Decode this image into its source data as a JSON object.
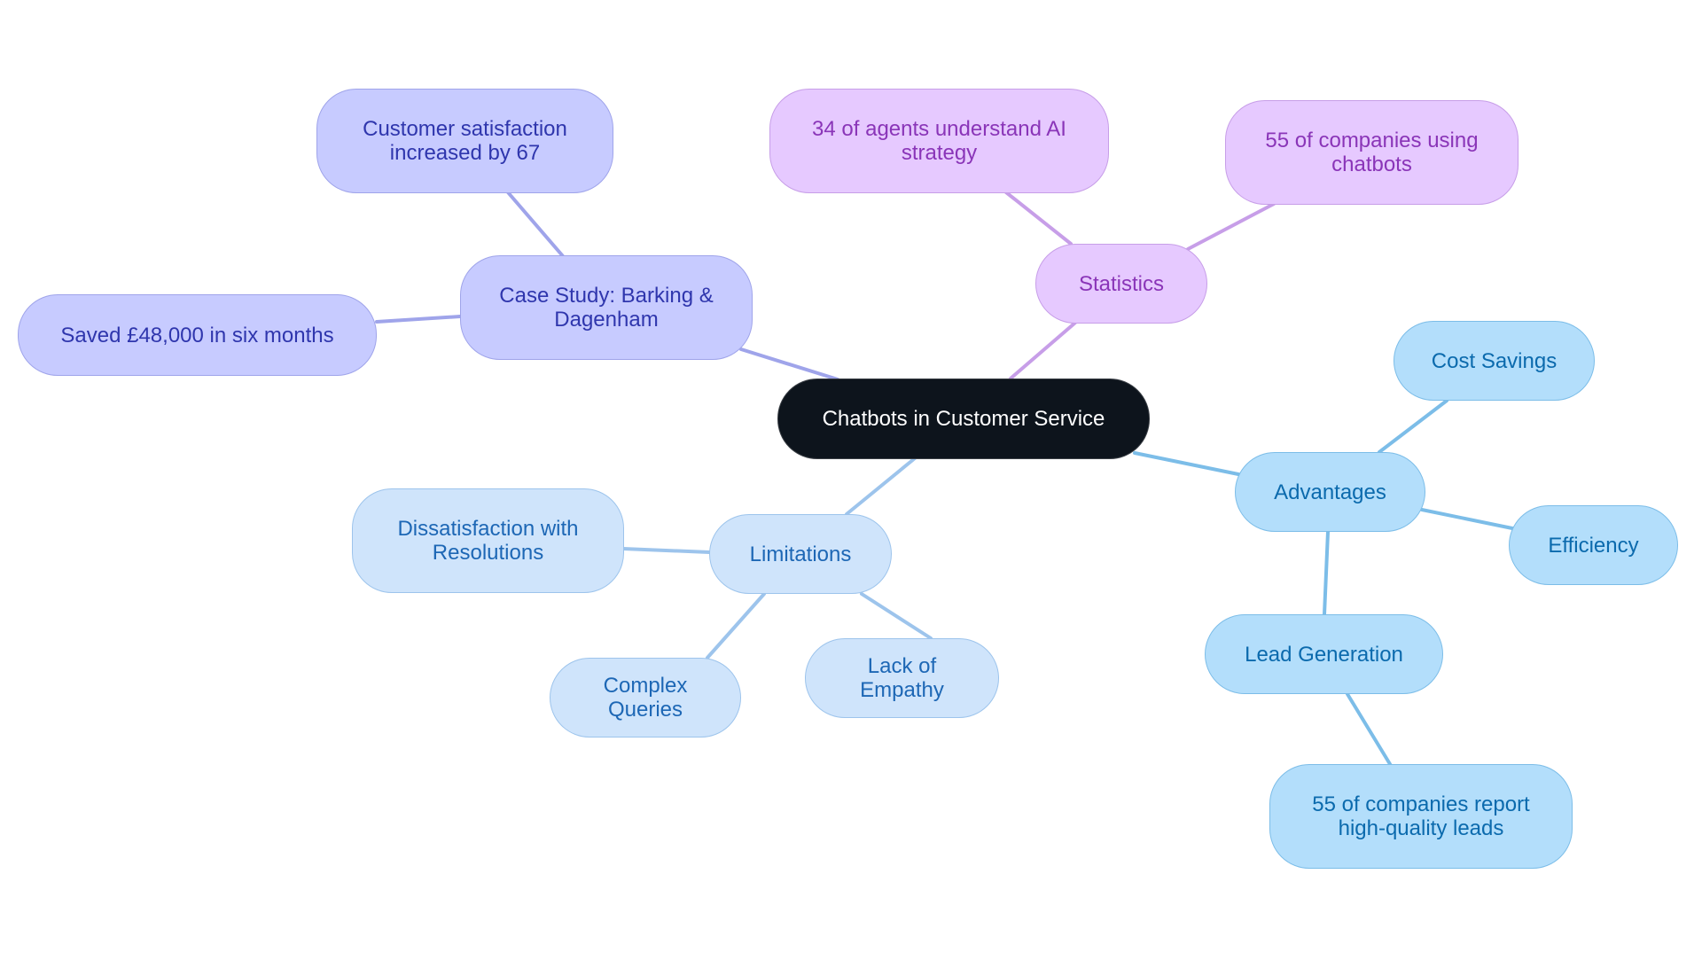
{
  "diagram": {
    "type": "mind-map",
    "root": {
      "id": "root",
      "label": "Chatbots in Customer Service"
    },
    "nodes": [
      {
        "id": "stats",
        "label": "Statistics",
        "parent": "root",
        "group": "purple"
      },
      {
        "id": "stat1",
        "label": "34 of agents understand AI strategy",
        "parent": "stats",
        "group": "purple"
      },
      {
        "id": "stat2",
        "label": "55 of companies using chatbots",
        "parent": "stats",
        "group": "purple"
      },
      {
        "id": "case",
        "label": "Case Study: Barking & Dagenham",
        "parent": "root",
        "group": "indigo"
      },
      {
        "id": "case1",
        "label": "Customer satisfaction increased by 67",
        "parent": "case",
        "group": "indigo"
      },
      {
        "id": "case2",
        "label": "Saved £48,000 in six months",
        "parent": "case",
        "group": "indigo"
      },
      {
        "id": "adv",
        "label": "Advantages",
        "parent": "root",
        "group": "sky"
      },
      {
        "id": "adv1",
        "label": "Cost Savings",
        "parent": "adv",
        "group": "sky"
      },
      {
        "id": "adv2",
        "label": "Efficiency",
        "parent": "adv",
        "group": "sky"
      },
      {
        "id": "adv3",
        "label": "Lead Generation",
        "parent": "adv",
        "group": "sky"
      },
      {
        "id": "adv3a",
        "label": "55 of companies report high-quality leads",
        "parent": "adv3",
        "group": "sky"
      },
      {
        "id": "lim",
        "label": "Limitations",
        "parent": "root",
        "group": "pale"
      },
      {
        "id": "lim1",
        "label": "Dissatisfaction with Resolutions",
        "parent": "lim",
        "group": "pale"
      },
      {
        "id": "lim2",
        "label": "Complex Queries",
        "parent": "lim",
        "group": "pale"
      },
      {
        "id": "lim3",
        "label": "Lack of Empathy",
        "parent": "lim",
        "group": "pale"
      }
    ],
    "edge_colors": {
      "purple": "#c79ee8",
      "indigo": "#9fa4ea",
      "sky": "#7cbde8",
      "pale": "#9dc4ec"
    }
  }
}
